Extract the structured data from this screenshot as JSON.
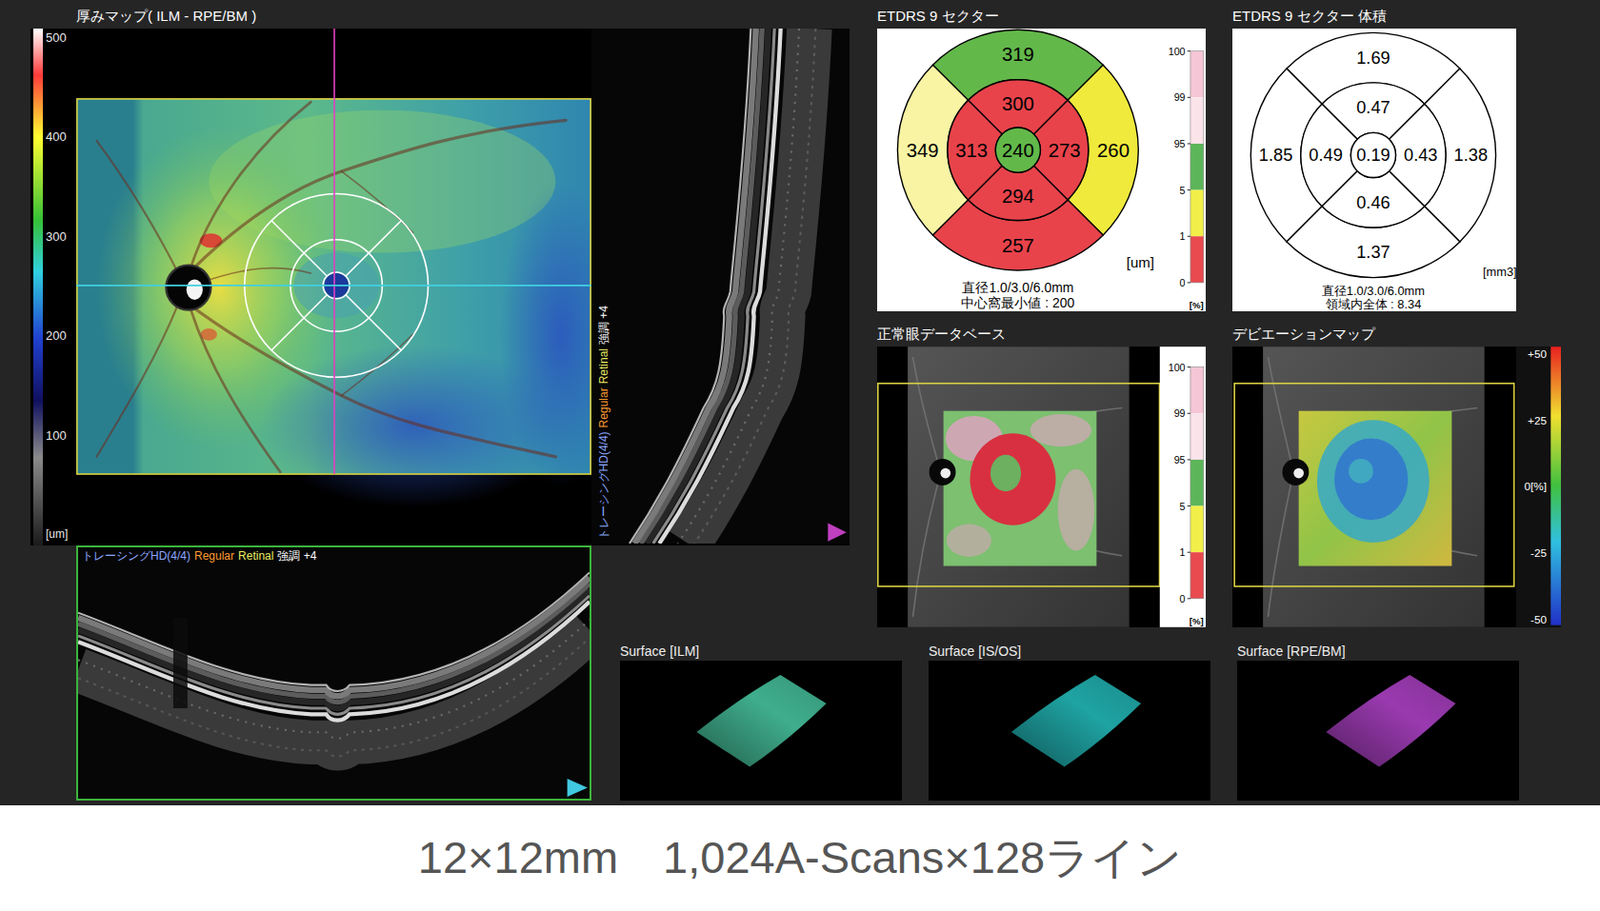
{
  "thickness_map": {
    "title": "厚みマップ( ILM - RPE/BM )",
    "scale_ticks": [
      "500",
      "400",
      "300",
      "200",
      "100"
    ],
    "scale_unit": "[um]"
  },
  "bscan_vertical": {
    "label": [
      {
        "text": "トレーシングHD(4/4)",
        "color": "#8aa8ff"
      },
      {
        "text": "Regular",
        "color": "#ff9a30"
      },
      {
        "text": "Retinal",
        "color": "#e8e860"
      },
      {
        "text": "強調 +4",
        "color": "#ffffff"
      }
    ]
  },
  "bscan_horizontal": {
    "label": [
      {
        "text": "トレーシングHD(4/4)",
        "color": "#8aa8ff"
      },
      {
        "text": "Regular",
        "color": "#ff9a30"
      },
      {
        "text": "Retinal",
        "color": "#e8e860"
      },
      {
        "text": "強調 +4",
        "color": "#ffffff"
      }
    ]
  },
  "etdrs": {
    "title": "ETDRS 9 セクター",
    "sectors": [
      {
        "kind": "outer-top",
        "value": "319",
        "color": "#63b84a"
      },
      {
        "kind": "outer-left",
        "value": "349",
        "color": "#f8f4a4"
      },
      {
        "kind": "outer-right",
        "value": "260",
        "color": "#f0ea3c"
      },
      {
        "kind": "outer-bottom",
        "value": "257",
        "color": "#e8434b"
      },
      {
        "kind": "inner-top",
        "value": "300",
        "color": "#e8434b"
      },
      {
        "kind": "inner-left",
        "value": "313",
        "color": "#e8434b"
      },
      {
        "kind": "inner-right",
        "value": "273",
        "color": "#e8434b"
      },
      {
        "kind": "inner-bottom",
        "value": "294",
        "color": "#e8434b"
      },
      {
        "kind": "center",
        "value": "240",
        "color": "#63b84a"
      }
    ],
    "unit": "[um]",
    "footer": [
      "直径1.0/3.0/6.0mm",
      "中心窩最小値 : 200"
    ],
    "legend": {
      "ticks": [
        "100",
        "99",
        "95",
        "5",
        "1",
        "0"
      ],
      "unit": "[%]",
      "bands": [
        {
          "color": "#f5c6d6"
        },
        {
          "color": "#fbe3ea"
        },
        {
          "color": "#5db55a"
        },
        {
          "color": "#f2ef4a"
        },
        {
          "color": "#e84a4f"
        }
      ]
    }
  },
  "etdrs_volume": {
    "title": "ETDRS 9 セクター 体積",
    "sectors": [
      {
        "kind": "outer-top",
        "value": "1.69"
      },
      {
        "kind": "outer-left",
        "value": "1.85"
      },
      {
        "kind": "outer-right",
        "value": "1.38"
      },
      {
        "kind": "outer-bottom",
        "value": "1.37"
      },
      {
        "kind": "inner-top",
        "value": "0.47"
      },
      {
        "kind": "inner-left",
        "value": "0.49"
      },
      {
        "kind": "inner-right",
        "value": "0.43"
      },
      {
        "kind": "inner-bottom",
        "value": "0.46"
      },
      {
        "kind": "center",
        "value": "0.19"
      }
    ],
    "unit": "[mm3]",
    "footer": [
      "直径1.0/3.0/6.0mm",
      "領域内全体 : 8.34"
    ]
  },
  "normal_database": {
    "title": "正常眼データベース",
    "legend": {
      "ticks": [
        "100",
        "99",
        "95",
        "5",
        "1",
        "0"
      ],
      "unit": "[%]",
      "bands": [
        {
          "color": "#f5c6d6"
        },
        {
          "color": "#fbe3ea"
        },
        {
          "color": "#5db55a"
        },
        {
          "color": "#f2ef4a"
        },
        {
          "color": "#e84a4f"
        }
      ]
    }
  },
  "deviation_map": {
    "title": "デビエーションマップ",
    "scale": [
      "+50",
      "+25",
      "0[%]",
      "-25",
      "-50"
    ]
  },
  "surfaces": [
    {
      "title": "Surface [ILM]",
      "color": "#3fae8c"
    },
    {
      "title": "Surface [IS/OS]",
      "color": "#1fa3a3"
    },
    {
      "title": "Surface [RPE/BM]",
      "color": "#9a3ab0"
    }
  ],
  "caption": "12×12mm　1,024A-Scans×128ライン"
}
